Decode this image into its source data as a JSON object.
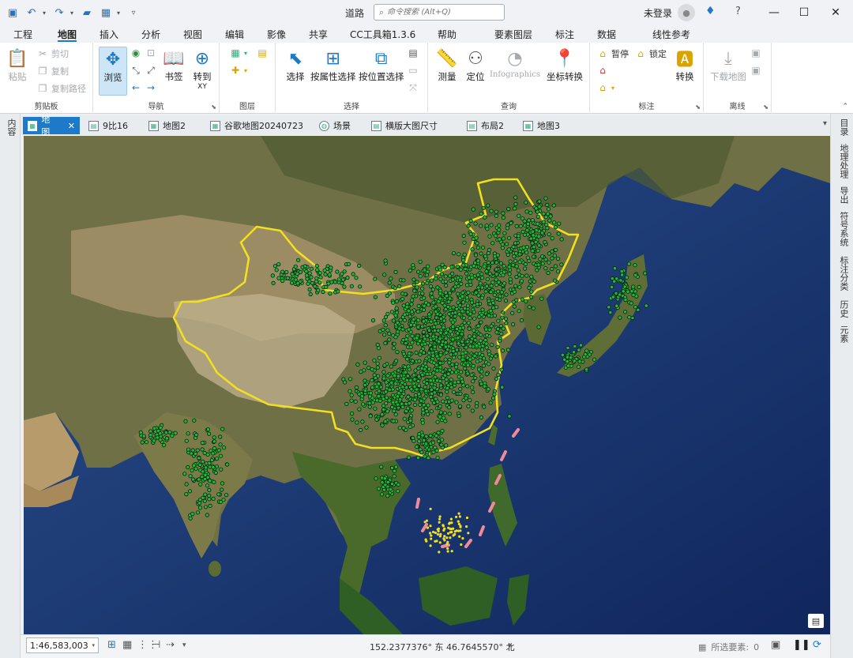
{
  "app": {
    "title": "道路",
    "search_placeholder": "命令搜索 (Alt+Q)",
    "signin": "未登录"
  },
  "ribbon_tabs": [
    "工程",
    "地图",
    "插入",
    "分析",
    "视图",
    "编辑",
    "影像",
    "共享",
    "CC工具箱1.3.6",
    "帮助",
    "要素图层",
    "标注",
    "数据",
    "线性参考"
  ],
  "ribbon": {
    "clipboard": {
      "label": "剪贴板",
      "paste": "粘贴",
      "cut": "剪切",
      "copy": "复制",
      "copy_path": "复制路径"
    },
    "navigate": {
      "label": "导航",
      "explore": "浏览",
      "bookmarks": "书签",
      "goto": "转到",
      "goto_xy": "XY"
    },
    "layer": {
      "label": "图层"
    },
    "selection": {
      "label": "选择",
      "select": "选择",
      "by_attr": "按属性选择",
      "by_loc": "按位置选择"
    },
    "inquiry": {
      "label": "查询",
      "measure": "测量",
      "locate": "定位",
      "infographics": "Infographics",
      "convert_coords": "坐标转换"
    },
    "labeling": {
      "label": "标注",
      "pause": "暂停",
      "lock": "锁定",
      "convert": "转换"
    },
    "offline": {
      "label": "离线",
      "download_map": "下载地图"
    }
  },
  "left_panel": {
    "label": "内容"
  },
  "right_panel": [
    "目录",
    "地理处理",
    "导出",
    "符号系统",
    "标注分类",
    "历史",
    "元素"
  ],
  "view_tabs": [
    {
      "label": "地图",
      "active": true,
      "icon": "map-icon"
    },
    {
      "label": "9比16",
      "icon": "layout-icon"
    },
    {
      "label": "地图2",
      "icon": "map-icon"
    },
    {
      "label": "谷歌地图20240723",
      "icon": "map-icon"
    },
    {
      "label": "场景",
      "icon": "globe-icon"
    },
    {
      "label": "横版大图尺寸",
      "icon": "layout-icon"
    },
    {
      "label": "布局2",
      "icon": "layout-icon"
    },
    {
      "label": "地图3",
      "icon": "map-icon"
    }
  ],
  "status": {
    "scale": "1:46,583,003",
    "coords": "152.2377376° 东  46.7645570° 北",
    "selected": "所选要素:",
    "selected_count": "0"
  },
  "colors": {
    "accent": "#1e79c8",
    "boundary": "#f0e020",
    "points": "#1fb83a",
    "dashes": "#f08a98"
  }
}
